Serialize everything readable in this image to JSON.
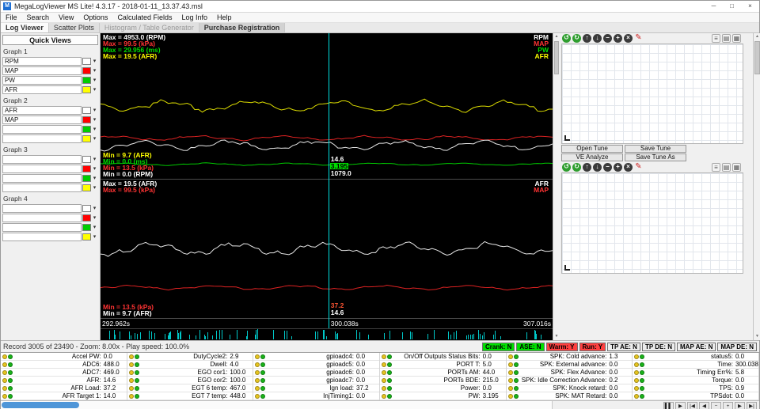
{
  "window": {
    "title": "MegaLogViewer MS Lite! 4.3.17 - 2018-01-11_13.37.43.msl",
    "app_initial": "M"
  },
  "icons": {
    "minimize": "─",
    "maximize": "□",
    "close": "×",
    "chevron_down": "▾",
    "scroll_up": "▲",
    "scroll_down": "▼"
  },
  "menu": [
    {
      "label": "File"
    },
    {
      "label": "Search"
    },
    {
      "label": "View"
    },
    {
      "label": "Options"
    },
    {
      "label": "Calculated Fields"
    },
    {
      "label": "Log Info"
    },
    {
      "label": "Help"
    }
  ],
  "tabs": [
    {
      "label": "Log Viewer",
      "state": "selected"
    },
    {
      "label": "Scatter Plots",
      "state": "normal"
    },
    {
      "label": "Histogram / Table Generator",
      "state": "disabled"
    },
    {
      "label": "Purchase Registration",
      "state": "highlight"
    }
  ],
  "sidebar": {
    "title": "Quick Views",
    "graphs": [
      {
        "label": "Graph 1",
        "channels": [
          {
            "name": "RPM",
            "color": "#ffffff"
          },
          {
            "name": "MAP",
            "color": "#ff0000"
          },
          {
            "name": "PW",
            "color": "#00cc00"
          },
          {
            "name": "AFR",
            "color": "#ffff00"
          }
        ]
      },
      {
        "label": "Graph 2",
        "channels": [
          {
            "name": "AFR",
            "color": "#ffffff"
          },
          {
            "name": "MAP",
            "color": "#ff0000"
          },
          {
            "name": "",
            "color": "#00cc00"
          },
          {
            "name": "",
            "color": "#ffff00"
          }
        ]
      },
      {
        "label": "Graph 3",
        "channels": [
          {
            "name": "",
            "color": "#ffffff"
          },
          {
            "name": "",
            "color": "#ff0000"
          },
          {
            "name": "",
            "color": "#00cc00"
          },
          {
            "name": "",
            "color": "#ffff00"
          }
        ]
      },
      {
        "label": "Graph 4",
        "channels": [
          {
            "name": "",
            "color": "#ffffff"
          },
          {
            "name": "",
            "color": "#ff0000"
          },
          {
            "name": "",
            "color": "#00cc00"
          },
          {
            "name": "",
            "color": "#ffff00"
          }
        ]
      }
    ]
  },
  "chart": {
    "cursor_left": "50.4%",
    "graphs": [
      {
        "max_labels": [
          {
            "text": "Max = 4953.0 (RPM)",
            "color": "#ffffff"
          },
          {
            "text": "Max = 99.5 (kPa)",
            "color": "#ff3333"
          },
          {
            "text": "Max = 29.956 (ms)",
            "color": "#00dd00"
          },
          {
            "text": "Max = 19.5 (AFR)",
            "color": "#ffff00"
          }
        ],
        "channel_labels": [
          {
            "text": "RPM",
            "color": "#ffffff"
          },
          {
            "text": "MAP",
            "color": "#ff3333"
          },
          {
            "text": "PW",
            "color": "#00dd00"
          },
          {
            "text": "AFR",
            "color": "#ffff00"
          }
        ],
        "min_labels": [
          {
            "text": "Min = 9.7 (AFR)",
            "color": "#ffff00"
          },
          {
            "text": "Min = 0.0 (ms)",
            "color": "#00dd00"
          },
          {
            "text": "Min = 13.5 (kPa)",
            "color": "#ff3333"
          },
          {
            "text": "Min = 0.0 (RPM)",
            "color": "#ffffff"
          }
        ],
        "cursor_values": [
          {
            "text": "14.6",
            "color": "#ffffff"
          },
          {
            "text": "3.195",
            "color": "#000000",
            "bg": "#00dd00"
          },
          {
            "text": "1079.0",
            "color": "#ffffff"
          }
        ],
        "lines": [
          {
            "color": "#dddd00",
            "base": 0.5,
            "amp": 0.03,
            "seed": 3
          },
          {
            "color": "#dd2222",
            "base": 0.72,
            "amp": 0.012,
            "seed": 5
          },
          {
            "color": "#e8e8e8",
            "base": 0.77,
            "amp": 0.025,
            "seed": 7
          },
          {
            "color": "#00cc00",
            "base": 0.9,
            "amp": 0.006,
            "seed": 11
          }
        ]
      },
      {
        "max_labels": [
          {
            "text": "Max = 19.5 (AFR)",
            "color": "#ffffff"
          },
          {
            "text": "Max = 99.5 (kPa)",
            "color": "#ff3333"
          }
        ],
        "channel_labels": [
          {
            "text": "AFR",
            "color": "#ffffff"
          },
          {
            "text": "MAP",
            "color": "#ff3333"
          }
        ],
        "min_labels": [
          {
            "text": "Min = 13.5 (kPa)",
            "color": "#ff3333"
          },
          {
            "text": "Min = 9.7 (AFR)",
            "color": "#ffffff"
          }
        ],
        "cursor_values": [
          {
            "text": "37.2",
            "color": "#ff5533"
          },
          {
            "text": "14.6",
            "color": "#ffffff"
          }
        ],
        "lines": [
          {
            "color": "#e8e8e8",
            "base": 0.5,
            "amp": 0.035,
            "seed": 13
          },
          {
            "color": "#dd2222",
            "base": 0.78,
            "amp": 0.012,
            "seed": 17
          }
        ]
      }
    ],
    "timeline": {
      "start": "292.962s",
      "cursor": "300.038s",
      "end": "307.016s"
    }
  },
  "tune": {
    "toolbar_main": [
      {
        "name": "undo-icon",
        "glyph": "↺",
        "bg": "#2f9e2f",
        "fg": "#ffffff",
        "shape": "circle"
      },
      {
        "name": "redo-icon",
        "glyph": "↻",
        "bg": "#2f9e2f",
        "fg": "#ffffff",
        "shape": "circle"
      },
      {
        "name": "scale-up-icon",
        "glyph": "↑",
        "bg": "#3b3b3b",
        "fg": "#ffffff",
        "shape": "circle"
      },
      {
        "name": "scale-down-icon",
        "glyph": "↓",
        "bg": "#3b3b3b",
        "fg": "#ffffff",
        "shape": "circle"
      },
      {
        "name": "decrement-icon",
        "glyph": "−",
        "bg": "#3b3b3b",
        "fg": "#ffffff",
        "shape": "circle"
      },
      {
        "name": "increment-icon",
        "glyph": "+",
        "bg": "#3b3b3b",
        "fg": "#ffffff",
        "shape": "circle"
      },
      {
        "name": "clear-icon",
        "glyph": "×",
        "bg": "#3b3b3b",
        "fg": "#ffffff",
        "shape": "circle"
      },
      {
        "name": "edit-icon",
        "glyph": "✎",
        "bg": "transparent",
        "fg": "#cc2222",
        "shape": "plain"
      }
    ],
    "toolbar_views": [
      {
        "name": "list-view-icon",
        "glyph": "≡",
        "bg": "#f3f3f3",
        "fg": "#555555",
        "shape": "square"
      },
      {
        "name": "table-view-icon",
        "glyph": "▤",
        "bg": "#f3f3f3",
        "fg": "#555555",
        "shape": "square"
      },
      {
        "name": "grid-view-icon",
        "glyph": "▦",
        "bg": "#f3f3f3",
        "fg": "#555555",
        "shape": "square"
      }
    ],
    "button_rows": [
      [
        {
          "label": "Open Tune"
        },
        {
          "label": "Save Tune"
        }
      ],
      [
        {
          "label": "VE Analyze"
        },
        {
          "label": "Save Tune As"
        }
      ]
    ]
  },
  "status": {
    "record_text": "Record 3005 of 23490 - Zoom: 8.00x - Play speed: 100.0%"
  },
  "indicators": [
    {
      "label": "Crank: N",
      "bg": "#00e000",
      "fg": "#000000"
    },
    {
      "label": "ASE: N",
      "bg": "#00e000",
      "fg": "#000000"
    },
    {
      "label": "Warm: Y",
      "bg": "#ff4040",
      "fg": "#000000"
    },
    {
      "label": "Run: Y",
      "bg": "#ff4040",
      "fg": "#000000"
    },
    {
      "label": "TP AE: N",
      "bg": "#ededed",
      "fg": "#000000"
    },
    {
      "label": "TP DE: N",
      "bg": "#ededed",
      "fg": "#000000"
    },
    {
      "label": "MAP AE: N",
      "bg": "#ededed",
      "fg": "#000000"
    },
    {
      "label": "MAP DE: N",
      "bg": "#ededed",
      "fg": "#000000"
    }
  ],
  "table": {
    "led_colors": [
      "#e6c520",
      "#19b219"
    ],
    "columns": [
      {
        "cells": [
          {
            "name": "Accel PW",
            "value": "0.0"
          },
          {
            "name": "ADC6",
            "value": "488.0"
          },
          {
            "name": "ADC7",
            "value": "469.0"
          },
          {
            "name": "AFR",
            "value": "14.6"
          },
          {
            "name": "AFR Load",
            "value": "37.2"
          },
          {
            "name": "AFR Target 1",
            "value": "14.0"
          }
        ]
      },
      {
        "cells": [
          {
            "name": "DutyCycle2",
            "value": "2.9"
          },
          {
            "name": "Dwell",
            "value": "4.0"
          },
          {
            "name": "EGO cor1",
            "value": "100.0"
          },
          {
            "name": "EGO cor2",
            "value": "100.0"
          },
          {
            "name": "EGT 6 temp",
            "value": "467.0"
          },
          {
            "name": "EGT 7 temp",
            "value": "448.0"
          }
        ]
      },
      {
        "cells": [
          {
            "name": "gpioadc4",
            "value": "0.0"
          },
          {
            "name": "gpioadc5",
            "value": "0.0"
          },
          {
            "name": "gpioadc6",
            "value": "0.0"
          },
          {
            "name": "gpioadc7",
            "value": "0.0"
          },
          {
            "name": "Ign load",
            "value": "37.2"
          },
          {
            "name": "InjTiming1",
            "value": "0.0"
          }
        ]
      },
      {
        "cells": [
          {
            "name": "On/Off Outputs Status Bits",
            "value": "0.0"
          },
          {
            "name": "PORT T",
            "value": "5.0"
          },
          {
            "name": "PORTs AM",
            "value": "44.0"
          },
          {
            "name": "PORTs BDE",
            "value": "215.0"
          },
          {
            "name": "Power",
            "value": "0.0"
          },
          {
            "name": "PW",
            "value": "3.195"
          }
        ]
      },
      {
        "cells": [
          {
            "name": "SPK: Cold advance",
            "value": "1.3"
          },
          {
            "name": "SPK: External advance",
            "value": "0.0"
          },
          {
            "name": "SPK: Flex Advance",
            "value": "0.0"
          },
          {
            "name": "SPK: Idle Correction Advance",
            "value": "0.2"
          },
          {
            "name": "SPK: Knock retard",
            "value": "0.0"
          },
          {
            "name": "SPK: MAT Retard",
            "value": "0.0"
          }
        ]
      },
      {
        "cells": [
          {
            "name": "status5",
            "value": "0.0"
          },
          {
            "name": "Time",
            "value": "300.038"
          },
          {
            "name": "Timing Err%",
            "value": "5.8"
          },
          {
            "name": "Torque",
            "value": "0.0"
          },
          {
            "name": "TPS",
            "value": "0.9"
          },
          {
            "name": "TPSdot",
            "value": "0.0"
          }
        ]
      }
    ]
  },
  "playback": [
    {
      "name": "pause-icon",
      "glyph": "▌▌"
    },
    {
      "name": "play-icon",
      "glyph": "▶"
    },
    {
      "name": "skip-start-icon",
      "glyph": "|◀"
    },
    {
      "name": "step-back-icon",
      "glyph": "◀"
    },
    {
      "name": "slower-icon",
      "glyph": "−"
    },
    {
      "name": "faster-icon",
      "glyph": "+"
    },
    {
      "name": "step-forward-icon",
      "glyph": "▶"
    },
    {
      "name": "skip-end-icon",
      "glyph": "▶|"
    }
  ]
}
